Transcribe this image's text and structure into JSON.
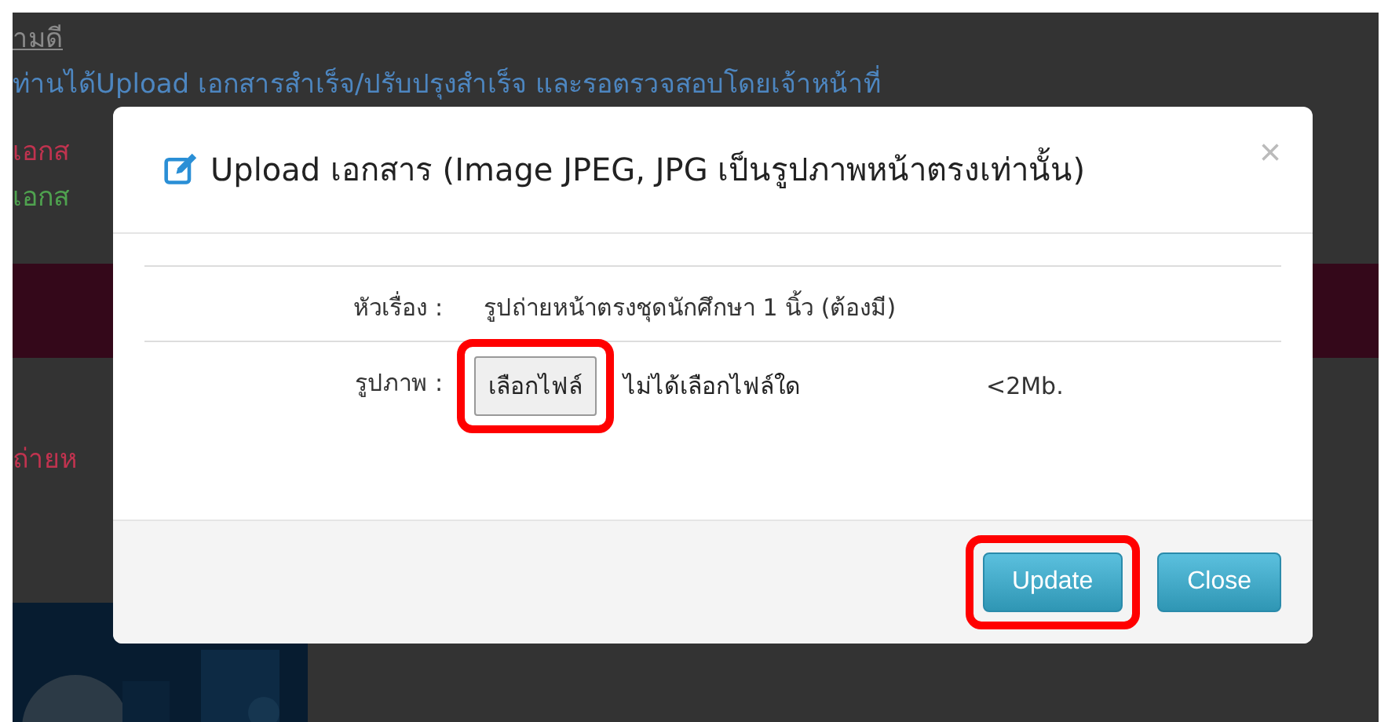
{
  "background": {
    "texts": [
      {
        "text": "ามดี",
        "kind": "link"
      },
      {
        "text": "ท่านได้Upload เอกสารสำเร็จ/ปรับปรุงสำเร็จ และรอตรวจสอบโดยเจ้าหน้าที่",
        "kind": "info"
      },
      {
        "text": "เอกส",
        "kind": "error"
      },
      {
        "text": "เอกส",
        "kind": "ok"
      },
      {
        "text": "ถ่ายห",
        "kind": "error"
      }
    ]
  },
  "modal": {
    "title": "Upload เอกสาร (Image JPEG, JPG เป็นรูปภาพหน้าตรงเท่านั้น)",
    "close": "×",
    "rows": [
      {
        "kind": "text",
        "label": "หัวเรื่อง :",
        "value": "รูปถ่ายหน้าตรงชุดนักศึกษา 1 นิ้ว (ต้องมี)"
      },
      {
        "kind": "file",
        "label": "รูปภาพ :",
        "button": "เลือกไฟล์",
        "highlighted": true,
        "status": "ไม่ได้เลือกไฟล์ใด",
        "hint": "<2Mb."
      }
    ],
    "buttons": [
      {
        "label": "Update",
        "highlighted": true
      },
      {
        "label": "Close",
        "highlighted": false
      }
    ]
  }
}
